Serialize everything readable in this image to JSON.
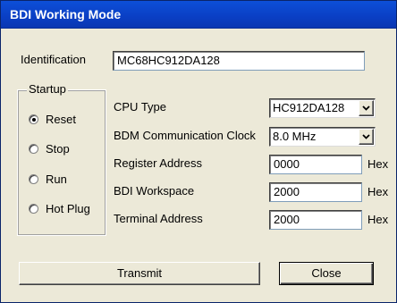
{
  "window": {
    "title": "BDI Working Mode"
  },
  "identification": {
    "label": "Identification",
    "value": "MC68HC912DA128"
  },
  "startup": {
    "title": "Startup",
    "options": [
      {
        "label": "Reset",
        "selected": true
      },
      {
        "label": "Stop",
        "selected": false
      },
      {
        "label": "Run",
        "selected": false
      },
      {
        "label": "Hot Plug",
        "selected": false
      }
    ]
  },
  "fields": {
    "cpu_type": {
      "label": "CPU Type",
      "value": "HC912DA128"
    },
    "bdm_clock": {
      "label": "BDM Communication Clock",
      "value": "8.0 MHz"
    },
    "register_address": {
      "label": "Register Address",
      "value": "0000",
      "unit": "Hex"
    },
    "bdi_workspace": {
      "label": "BDI Workspace",
      "value": "2000",
      "unit": "Hex"
    },
    "terminal_address": {
      "label": "Terminal Address",
      "value": "2000",
      "unit": "Hex"
    }
  },
  "buttons": {
    "transmit": "Transmit",
    "close": "Close"
  },
  "icons": {
    "dropdown": "chevron-down-icon"
  },
  "colors": {
    "title_bar": "#0a3fc4",
    "dialog_bg": "#ece9d8"
  }
}
